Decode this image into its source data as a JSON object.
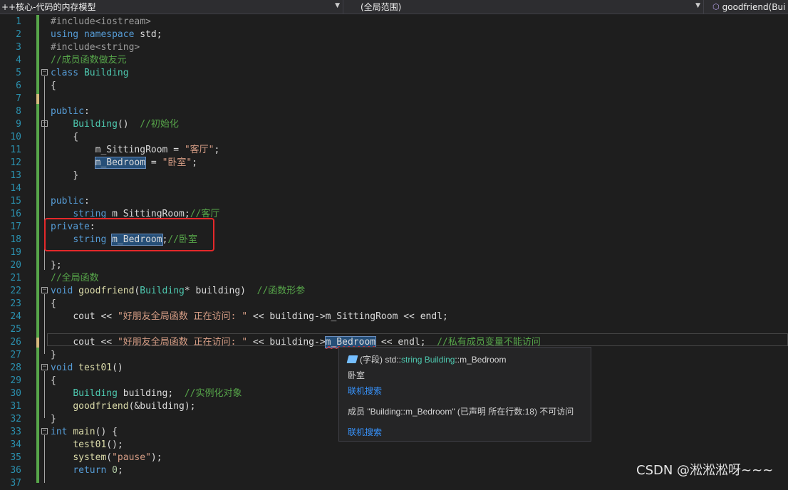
{
  "navbar": {
    "file_dropdown": "++核心-代码的内存模型",
    "scope_dropdown": "(全局范围)",
    "member_dropdown": "goodfriend(Bui",
    "member_icon": "cube-icon"
  },
  "line_numbers": [
    "1",
    "2",
    "3",
    "4",
    "5",
    "6",
    "7",
    "8",
    "9",
    "10",
    "11",
    "12",
    "13",
    "14",
    "15",
    "16",
    "17",
    "18",
    "19",
    "20",
    "21",
    "22",
    "23",
    "24",
    "25",
    "26",
    "27",
    "28",
    "29",
    "30",
    "31",
    "32",
    "33",
    "34",
    "35",
    "36",
    "37"
  ],
  "code": {
    "l1": "#include<iostream>",
    "l2a": "using",
    "l2b": "namespace",
    "l2c": " std;",
    "l3": "#include<string>",
    "l4": "//成员函数做友元",
    "l5a": "class",
    "l5b": "Building",
    "l6": "{",
    "l8a": "public",
    "l8b": ":",
    "l9a": "Building",
    "l9b": "()  ",
    "l9c": "//初始化",
    "l10": "{",
    "l11a": "m_SittingRoom",
    "l11b": " = ",
    "l11c": "\"客厅\"",
    "l11d": ";",
    "l12a": "m_Bedroom",
    "l12b": " = ",
    "l12c": "\"卧室\"",
    "l12d": ";",
    "l13": "}",
    "l15a": "public",
    "l15b": ":",
    "l16a": "string",
    "l16b": " m_SittingRoom;",
    "l16c": "//客厅",
    "l17a": "private",
    "l17b": ":",
    "l18a": "string",
    "l18b": "m_Bedroom",
    "l18c": ";",
    "l18d": "//卧室",
    "l20": "};",
    "l21": "//全局函数",
    "l22a": "void",
    "l22b": "goodfriend",
    "l22c": "(",
    "l22d": "Building",
    "l22e": "* building)  ",
    "l22f": "//函数形参",
    "l23": "{",
    "l24a": "cout << ",
    "l24b": "\"好朋友全局函数 正在访问: \"",
    "l24c": " << building->",
    "l24d": "m_SittingRoom",
    "l24e": " << endl;",
    "l26a": "cout << ",
    "l26b": "\"好朋友全局函数 正在访问: \"",
    "l26c": " << building->",
    "l26d": "m_Bedroom",
    "l26e": " << endl;  ",
    "l26f": "//私有成员变量不能访问",
    "l27": "}",
    "l28a": "void",
    "l28b": "test01",
    "l28c": "()",
    "l29": "{",
    "l30a": "Building",
    "l30b": " building;  ",
    "l30c": "//实例化对象",
    "l31a": "goodfriend",
    "l31b": "(&building);",
    "l32": "}",
    "l33a": "int",
    "l33b": "main",
    "l33c": "() {",
    "l34a": "test01",
    "l34b": "();",
    "l35a": "system",
    "l35b": "(",
    "l35c": "\"pause\"",
    "l35d": ");",
    "l36a": "return",
    "l36b": "0",
    "l36c": ";"
  },
  "tooltip": {
    "field_icon": "field-icon",
    "kind": "(字段)",
    "sig_ns": "std::",
    "sig_type": "string",
    "sig_class": "Building",
    "sig_member": "::m_Bedroom",
    "comment": "卧室",
    "search_link": "联机搜索",
    "error": "成员 \"Building::m_Bedroom\" (已声明 所在行数:18) 不可访问",
    "search_link2": "联机搜索"
  },
  "watermark": "CSDN @淞淞淞呀~~~",
  "colors": {
    "background": "#1e1e1e",
    "keyword": "#569cd6",
    "type": "#4ec9b0",
    "comment": "#57a64a",
    "string": "#d69d85",
    "line_number": "#2b91af",
    "annotation_box": "#e5282a"
  }
}
